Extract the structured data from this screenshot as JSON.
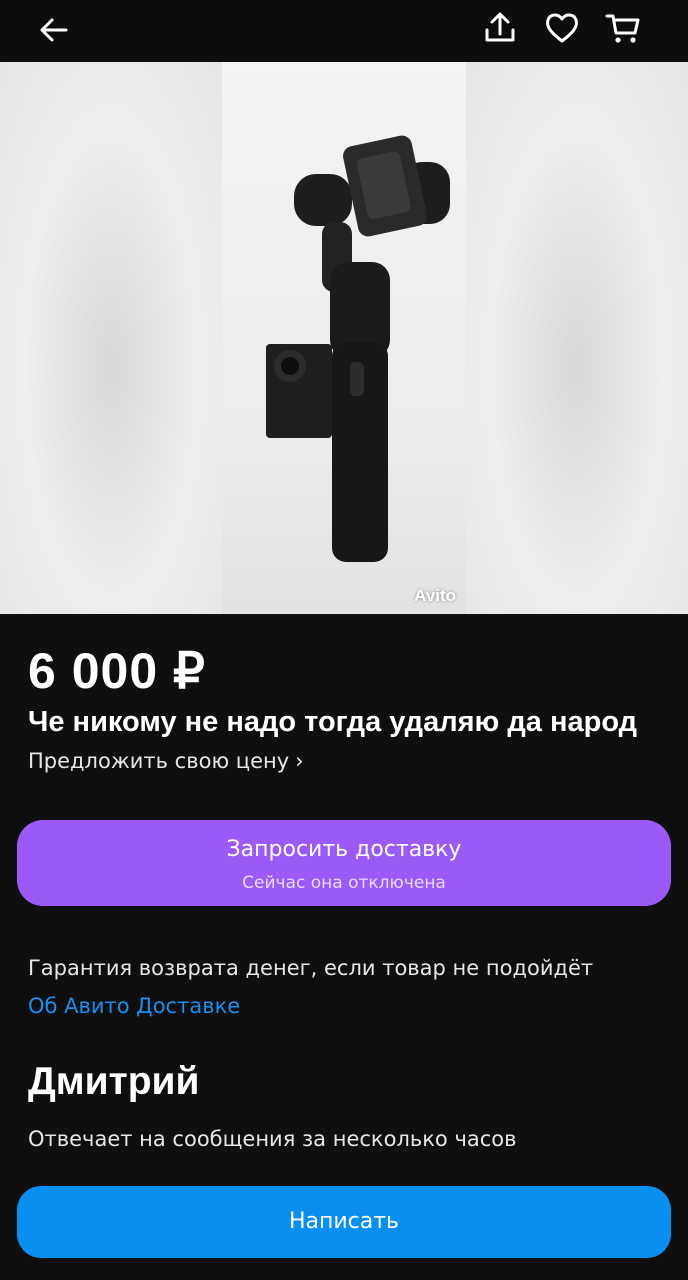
{
  "header": {
    "icons": [
      "arrow-left-icon",
      "share-icon",
      "heart-icon",
      "cart-icon"
    ]
  },
  "gallery": {
    "watermark": "Avito"
  },
  "listing": {
    "price": "6 000 ₽",
    "title": "Че никому не надо тогда удаляю да народ",
    "offer_price_label": "Предложить свою цену",
    "offer_chevron": "›"
  },
  "delivery": {
    "button_label": "Запросить доставку",
    "button_sublabel": "Сейчас она отключена",
    "color": "#9b59f5"
  },
  "guarantee": {
    "text": "Гарантия возврата денег, если товар не подойдёт",
    "link": "Об Авито Доставке"
  },
  "seller": {
    "name": "Дмитрий",
    "reply_time": "Отвечает на сообщения за несколько часов"
  },
  "write_button": {
    "label": "Написать",
    "color": "#0a8ef0"
  }
}
